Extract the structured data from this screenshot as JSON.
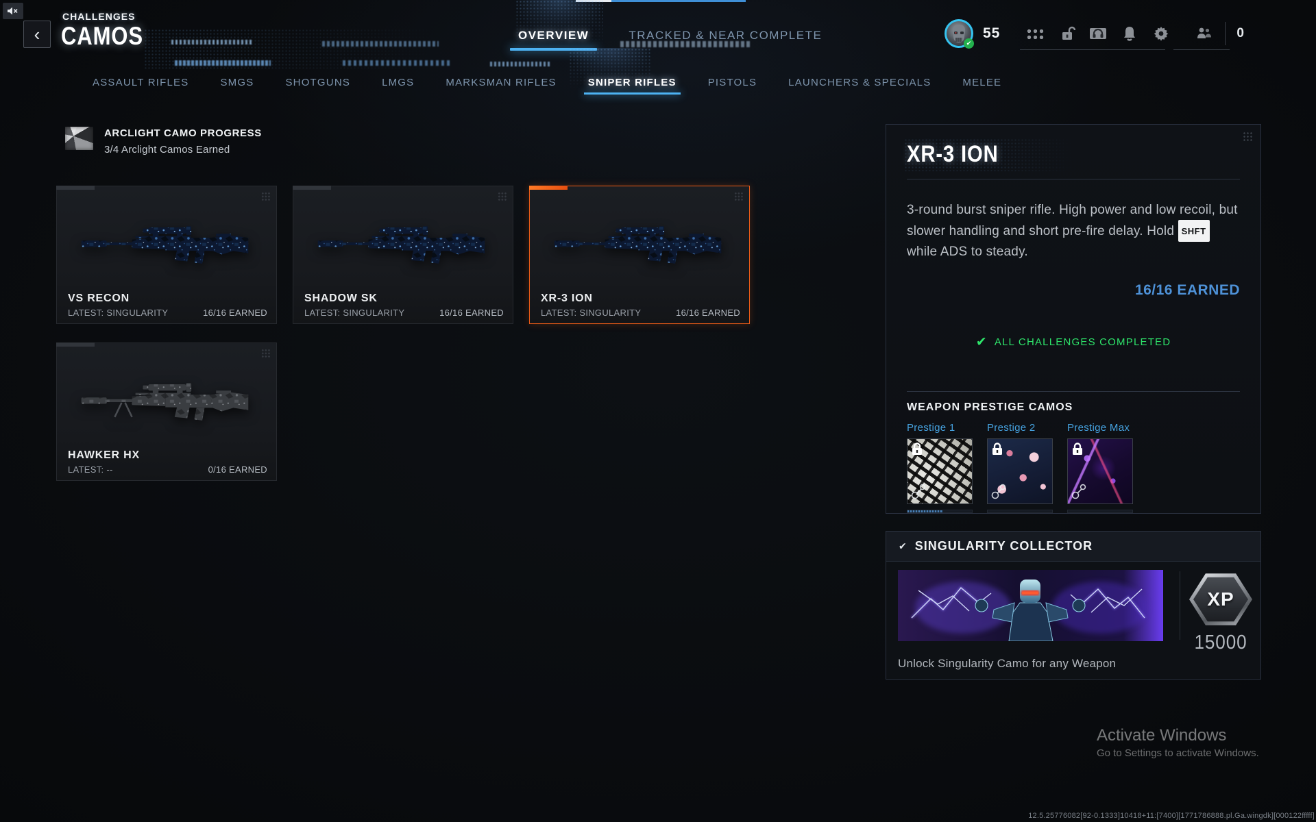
{
  "colors": {
    "accent_blue": "#4db2f2",
    "earned_blue": "#4e92d8",
    "success_green": "#2ee46a",
    "selection_orange": "#e85a17",
    "ring_cyan": "#35c3f0"
  },
  "icons": [
    "volume-muted-icon",
    "back-chevron-icon",
    "player-avatar",
    "grid-dots-icon",
    "unlock-icon",
    "theater-icon",
    "bell-icon",
    "gear-icon",
    "social-icon",
    "lock-icon",
    "check-icon",
    "xp-hex-badge"
  ],
  "topbar": {
    "back_glyph": "‹",
    "eyebrow": "CHALLENGES",
    "title": "CAMOS",
    "player_level": "55",
    "currency": "0"
  },
  "main_tabs": [
    {
      "label": "OVERVIEW",
      "active": true
    },
    {
      "label": "TRACKED & NEAR COMPLETE",
      "active": false
    }
  ],
  "category_tabs": [
    {
      "label": "ASSAULT RIFLES",
      "active": false
    },
    {
      "label": "SMGS",
      "active": false
    },
    {
      "label": "SHOTGUNS",
      "active": false
    },
    {
      "label": "LMGS",
      "active": false
    },
    {
      "label": "MARKSMAN RIFLES",
      "active": false
    },
    {
      "label": "SNIPER RIFLES",
      "active": true
    },
    {
      "label": "PISTOLS",
      "active": false
    },
    {
      "label": "LAUNCHERS & SPECIALS",
      "active": false
    },
    {
      "label": "MELEE",
      "active": false
    }
  ],
  "progress_header": {
    "title": "ARCLIGHT CAMO PROGRESS",
    "subtitle": "3/4 Arclight Camos Earned"
  },
  "weapons": [
    {
      "name": "VS RECON",
      "latest": "LATEST: SINGULARITY",
      "earned": "16/16 EARNED"
    },
    {
      "name": "SHADOW SK",
      "latest": "LATEST: SINGULARITY",
      "earned": "16/16 EARNED"
    },
    {
      "name": "XR-3 ION",
      "latest": "LATEST: SINGULARITY",
      "earned": "16/16 EARNED"
    },
    {
      "name": "HAWKER HX",
      "latest": "LATEST: --",
      "earned": "0/16 EARNED"
    }
  ],
  "detail_panel": {
    "title": "XR-3 ION",
    "description_pre": "3-round burst sniper rifle. High power and low recoil, but slower handling and short pre-fire delay. Hold ",
    "key_label": "SHFT",
    "description_post": " while ADS to steady.",
    "earned": "16/16 EARNED",
    "completed_check": "✔",
    "completed": "ALL CHALLENGES COMPLETED",
    "prestige_heading": "WEAPON PRESTIGE CAMOS",
    "prestige": [
      {
        "label": "Prestige 1"
      },
      {
        "label": "Prestige 2"
      },
      {
        "label": "Prestige Max"
      }
    ]
  },
  "collector_panel": {
    "check_glyph": "✔",
    "title": "SINGULARITY COLLECTOR",
    "xp_label": "XP",
    "xp_value": "15000",
    "caption": "Unlock Singularity Camo for any Weapon"
  },
  "watermark": {
    "line1": "Activate Windows",
    "line2": "Go to Settings to activate Windows."
  },
  "version": "12.5.25776082[92-0.1333]10418+11:[7400][1771786888.pl.Ga.wingdk][000122fffff]"
}
